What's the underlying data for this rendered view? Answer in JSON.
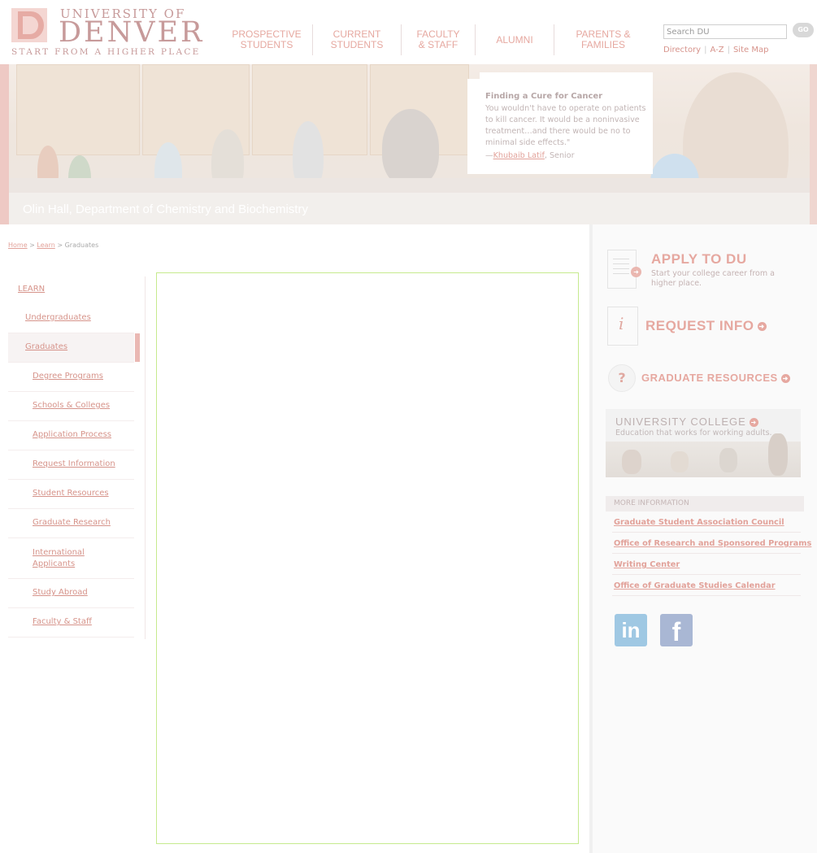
{
  "header": {
    "logo": {
      "line1": "UNIVERSITY OF",
      "line2": "DENVER",
      "tagline": "START FROM A HIGHER PLACE"
    },
    "nav": [
      {
        "label": "PROSPECTIVE\nSTUDENTS"
      },
      {
        "label": "CURRENT\nSTUDENTS"
      },
      {
        "label": "FACULTY\n& STAFF"
      },
      {
        "label": "ALUMNI"
      },
      {
        "label": "PARENTS &\nFAMILIES"
      }
    ],
    "search": {
      "placeholder": "Search DU",
      "go_label": "GO"
    },
    "util_links": {
      "directory": "Directory",
      "a_z": "A-Z",
      "site_map": "Site Map",
      "sep": "|"
    }
  },
  "hero": {
    "caption": "Olin Hall, Department of Chemistry and Biochemistry",
    "quote_title": "Finding a Cure for Cancer",
    "quote_text": "You wouldn't have to operate on patients to kill cancer. It would be a noninvasive treatment…and there would be no to minimal side effects.\"",
    "quote_dash": "—",
    "quote_author": "Khubaib Latif",
    "quote_role": ", Senior"
  },
  "breadcrumb": {
    "home": "Home",
    "sep": " > ",
    "learn": "Learn",
    "current": "Graduates"
  },
  "leftnav": {
    "heading": "LEARN",
    "items": [
      {
        "label": "Undergraduates"
      },
      {
        "label": "Graduates"
      },
      {
        "label": "Degree Programs"
      },
      {
        "label": "Schools & Colleges"
      },
      {
        "label": "Application Process"
      },
      {
        "label": "Request Information"
      },
      {
        "label": "Student Resources"
      },
      {
        "label": "Graduate Research"
      },
      {
        "label": "International Applicants"
      },
      {
        "label": "Study Abroad"
      },
      {
        "label": "Faculty & Staff"
      }
    ]
  },
  "sidebar": {
    "apply_title": "APPLY TO DU",
    "apply_sub": "Start your college career from a higher place.",
    "request_title": "REQUEST INFO",
    "grad_resources_title": "GRADUATE RESOURCES",
    "uc_title": "UNIVERSITY COLLEGE",
    "uc_sub": "Education that works for working adults.",
    "more_info_heading": "MORE INFORMATION",
    "more_info_links": [
      {
        "label": "Graduate Student Association Council"
      },
      {
        "label": "Office of Research and Sponsored Programs"
      },
      {
        "label": "Writing Center"
      },
      {
        "label": "Office of Graduate Studies Calendar"
      }
    ],
    "social": {
      "linkedin": "in",
      "facebook": "f"
    }
  },
  "colors": {
    "brand": "#e6a8a0",
    "link": "#d6938a",
    "content_border": "#c6ea8e"
  }
}
